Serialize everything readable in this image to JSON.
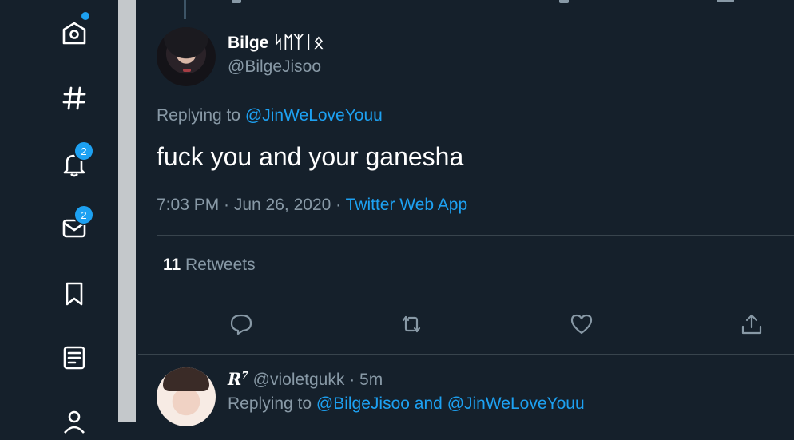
{
  "sidebar": {
    "nav": [
      {
        "icon": "home-icon",
        "badge": null
      },
      {
        "icon": "hashtag-icon",
        "badge": null
      },
      {
        "icon": "bell-icon",
        "badge": "2"
      },
      {
        "icon": "mail-icon",
        "badge": "2"
      },
      {
        "icon": "bookmark-icon",
        "badge": null
      },
      {
        "icon": "list-icon",
        "badge": null
      },
      {
        "icon": "profile-icon",
        "badge": null
      }
    ]
  },
  "tweet": {
    "display_name": "Bilge ᛋᛖᛉᛁᛟ",
    "handle": "@BilgeJisoo",
    "replying_prefix": "Replying to",
    "replying_to": "@JinWeLoveYouu",
    "text": "fuck you and your ganesha",
    "timestamp": "7:03 PM · Jun 26, 2020",
    "separator": " · ",
    "source": "Twitter Web App",
    "retweet_count": "11",
    "retweet_label": "Retweets"
  },
  "reply": {
    "display_name": "R",
    "display_name_sup": "7",
    "handle": "@violetgukk",
    "dot": "·",
    "time": "5m",
    "replying_prefix": "Replying to",
    "replying_user1": "@BilgeJisoo",
    "replying_and": "and",
    "replying_user2": "@JinWeLoveYouu"
  },
  "colors": {
    "background": "#15202b",
    "accent": "#1da1f2",
    "muted": "#8899a6",
    "border": "#38444d"
  }
}
